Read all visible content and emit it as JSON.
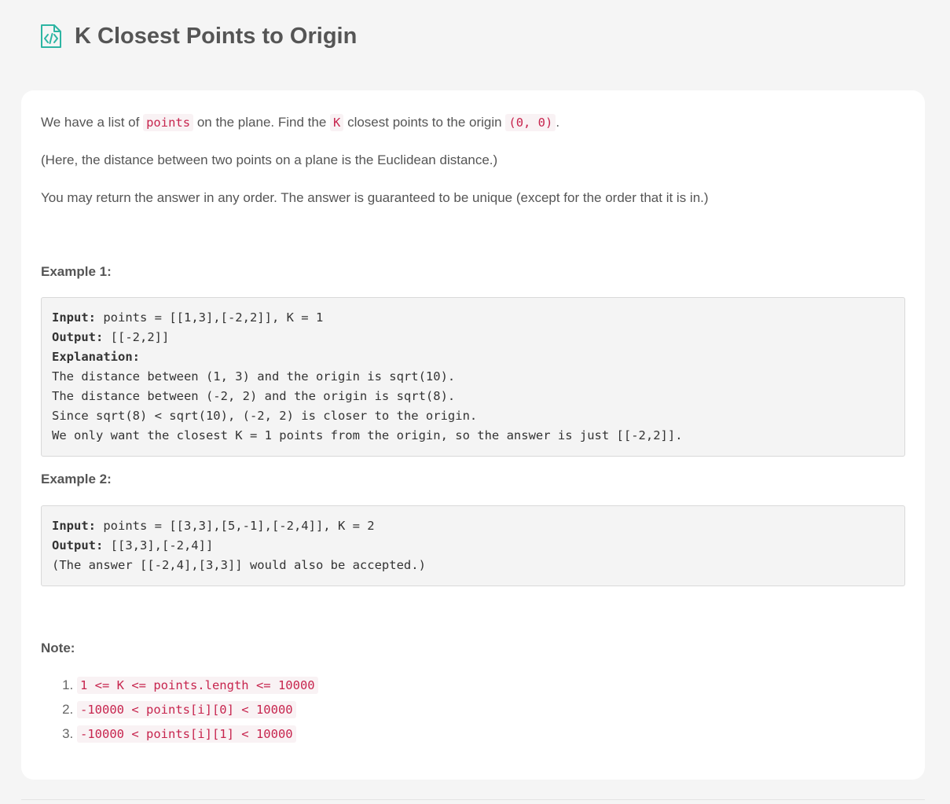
{
  "problem": {
    "title": "K Closest Points to Origin",
    "icon": "code-file-icon",
    "accent_color": "#2db5a3"
  },
  "description": {
    "p1": {
      "t1": "We have a list of ",
      "c1": "points",
      "t2": " on the plane.  Find the ",
      "c2": "K",
      "t3": " closest points to the origin ",
      "c3": "(0, 0)",
      "t4": "."
    },
    "p2": "(Here, the distance between two points on a plane is the Euclidean distance.)",
    "p3": "You may return the answer in any order.  The answer is guaranteed to be unique (except for the order that it is in.)"
  },
  "example1": {
    "heading": "Example 1:",
    "input_label": "Input:",
    "input_value": " points = [[1,3],[-2,2]], K = 1",
    "output_label": "Output:",
    "output_value": " [[-2,2]]",
    "explanation_label": "Explanation:",
    "lines": [
      "The distance between (1, 3) and the origin is sqrt(10).",
      "The distance between (-2, 2) and the origin is sqrt(8).",
      "Since sqrt(8) < sqrt(10), (-2, 2) is closer to the origin.",
      "We only want the closest K = 1 points from the origin, so the answer is just [[-2,2]]."
    ]
  },
  "example2": {
    "heading": "Example 2:",
    "input_label": "Input:",
    "input_value": " points = [[3,3],[5,-1],[-2,4]], K = 2",
    "output_label": "Output:",
    "output_value": " [[3,3],[-2,4]]",
    "note_line": "(The answer [[-2,4],[3,3]] would also be accepted.)"
  },
  "note": {
    "heading": "Note:",
    "items": [
      "1 <= K <= points.length <= 10000",
      "-10000 < points[i][0] < 10000",
      "-10000 < points[i][1] < 10000"
    ]
  }
}
